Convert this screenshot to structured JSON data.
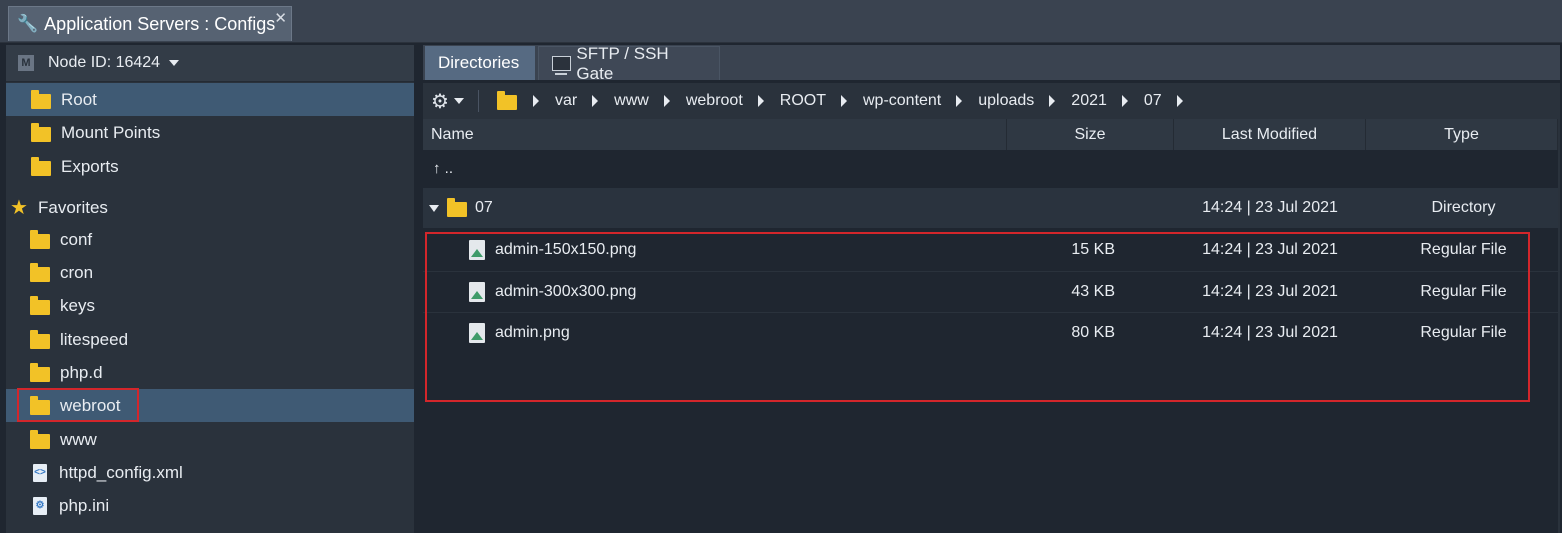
{
  "window": {
    "title": "Application Servers : Configs",
    "close": "✕"
  },
  "left": {
    "node_label": "Node ID: 16424",
    "node_badge": "M",
    "roots": [
      {
        "label": "Root",
        "icon": "folder-icon"
      },
      {
        "label": "Mount Points",
        "icon": "mount-folder-icon"
      },
      {
        "label": "Exports",
        "icon": "export-folder-icon"
      }
    ],
    "favorites_label": "Favorites",
    "favorites": [
      {
        "label": "conf",
        "icon": "folder-icon"
      },
      {
        "label": "cron",
        "icon": "folder-icon"
      },
      {
        "label": "keys",
        "icon": "folder-icon"
      },
      {
        "label": "litespeed",
        "icon": "folder-icon"
      },
      {
        "label": "php.d",
        "icon": "folder-icon"
      },
      {
        "label": "webroot",
        "icon": "folder-icon"
      },
      {
        "label": "www",
        "icon": "folder-icon"
      },
      {
        "label": "httpd_config.xml",
        "icon": "xml-file-icon"
      },
      {
        "label": "php.ini",
        "icon": "config-file-icon"
      }
    ]
  },
  "tabs": [
    {
      "label": "Directories"
    },
    {
      "label": "SFTP / SSH Gate"
    }
  ],
  "path": [
    "var",
    "www",
    "webroot",
    "ROOT",
    "wp-content",
    "uploads",
    "2021",
    "07"
  ],
  "columns": {
    "name": "Name",
    "size": "Size",
    "modified": "Last Modified",
    "type": "Type"
  },
  "up_label": "↑  ..",
  "rows": [
    {
      "name": "07",
      "size": "",
      "modified": "14:24 | 23 Jul 2021",
      "type": "Directory"
    },
    {
      "name": "admin-150x150.png",
      "size": "15 KB",
      "modified": "14:24 | 23 Jul 2021",
      "type": "Regular File"
    },
    {
      "name": "admin-300x300.png",
      "size": "43 KB",
      "modified": "14:24 | 23 Jul 2021",
      "type": "Regular File"
    },
    {
      "name": "admin.png",
      "size": "80 KB",
      "modified": "14:24 | 23 Jul 2021",
      "type": "Regular File"
    }
  ],
  "colors": {
    "selection": "#3f5a74",
    "folder": "#f2c227",
    "highlight": "#d3262b"
  }
}
